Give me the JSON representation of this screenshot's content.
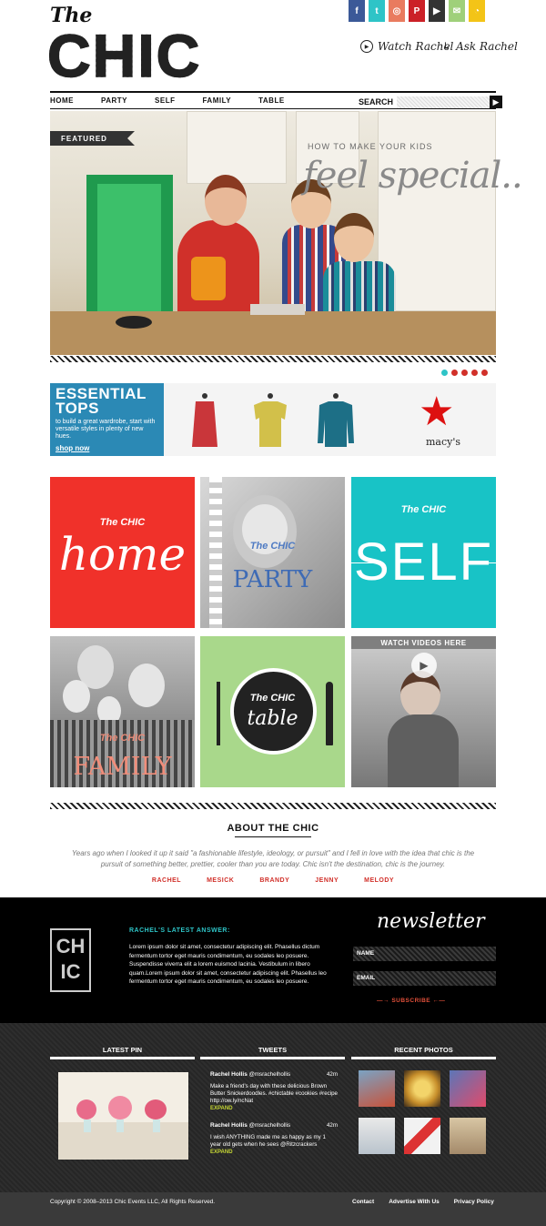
{
  "header": {
    "logo_the": "The",
    "logo_chic": "CHIC",
    "watch": "Watch Rachel",
    "ask": "Ask Rachel",
    "social": [
      {
        "name": "facebook-icon",
        "glyph": "f",
        "color": "#3b5998"
      },
      {
        "name": "twitter-icon",
        "glyph": "t",
        "color": "#2ec4c7"
      },
      {
        "name": "instagram-icon",
        "glyph": "◎",
        "color": "#e97b5f"
      },
      {
        "name": "pinterest-icon",
        "glyph": "P",
        "color": "#cb2027"
      },
      {
        "name": "youtube-icon",
        "glyph": "▶",
        "color": "#333333"
      },
      {
        "name": "email-icon",
        "glyph": "✉",
        "color": "#9fd07a"
      },
      {
        "name": "rss-icon",
        "glyph": "◔",
        "color": "#f3c417"
      }
    ]
  },
  "nav": {
    "items": [
      "HOME",
      "PARTY",
      "SELF",
      "FAMILY",
      "TABLE"
    ],
    "search_label": "SEARCH",
    "search_button": "▶"
  },
  "hero": {
    "badge": "FEATURED",
    "kicker": "HOW TO MAKE YOUR KIDS",
    "title": "feel special..",
    "dots": [
      "#2ec4c7",
      "#d1302a",
      "#d1302a",
      "#d1302a",
      "#d1302a"
    ]
  },
  "ad": {
    "title1": "ESSENTIAL",
    "title2": "TOPS",
    "body": "to build a great wardrobe, start with versatile styles in plenty of new hues.",
    "link": "shop now",
    "brand": "macy's"
  },
  "tiles": {
    "home": {
      "chic": "The CHIC",
      "label": "home"
    },
    "party": {
      "chic": "The CHIC",
      "label": "PARTY"
    },
    "self": {
      "chic": "The CHIC",
      "label": "SELF"
    },
    "family": {
      "chic": "The CHIC",
      "label": "FAMILY"
    },
    "table": {
      "chic": "The CHIC",
      "label": "table"
    },
    "videos": {
      "label": "WATCH VIDEOS HERE"
    }
  },
  "about": {
    "title": "ABOUT THE CHIC",
    "text": "Years ago when I looked it up it said \"a fashionable lifestyle, ideology, or pursuit\" and I fell in love with the idea that chic is the pursuit of something better, prettier, cooler than you are today. Chic isn't the destination, chic is the journey.",
    "tags": [
      "RACHEL",
      "MESICK",
      "BRANDY",
      "JENNY",
      "MELODY"
    ]
  },
  "answer": {
    "logo_top": "CH",
    "logo_bottom": "IC",
    "heading": "RACHEL'S LATEST ANSWER:",
    "text": "Lorem ipsum dolor sit amet, consectetur adipiscing elit. Phasellus dictum fermentum tortor eget mauris condimentum, eu sodales leo posuere. Suspendisse viverra elit a lorem euismod lacinia. Vestibulum in libero quam.Lorem ipsum dolor sit amet, consectetur adipiscing elit. Phasellus leo fermentum tortor eget mauris condimentum, eu sodales leo posuere."
  },
  "newsletter": {
    "title": "newsletter",
    "name_label": "NAME",
    "email_label": "EMAIL",
    "subscribe": "SUBSCRIBE"
  },
  "footer_cols": {
    "pin_title": "LATEST PIN",
    "tweets_title": "TWEETS",
    "photos_title": "RECENT PHOTOS",
    "tweets": [
      {
        "name": "Rachel Hollis",
        "handle": "@msrachelhollis",
        "time": "42m",
        "text": "Make a friend's day with these delicious Brown Butter Snickerdoodles. #chictable #cookies #recipe http://ow.ly/ncNat",
        "expand": "EXPAND"
      },
      {
        "name": "Rachel Hollis",
        "handle": "@msrachelhollis",
        "time": "42m",
        "text": "I wish ANYTHING made me as happy as my 1 year old gets when he sees @Ritzcrackers",
        "expand": "EXPAND"
      }
    ]
  },
  "bottom": {
    "copyright": "Copyright © 2008–2013 Chic Events LLC, All Rights Reserved.",
    "links": [
      "Contact",
      "Advertise With Us",
      "Privacy Policy"
    ]
  },
  "colors": {
    "accent_red": "#d1302a",
    "accent_teal": "#2ec4c7",
    "tile_red": "#f0312a",
    "tile_teal": "#18c3c6",
    "tile_green": "#a9d88b"
  }
}
